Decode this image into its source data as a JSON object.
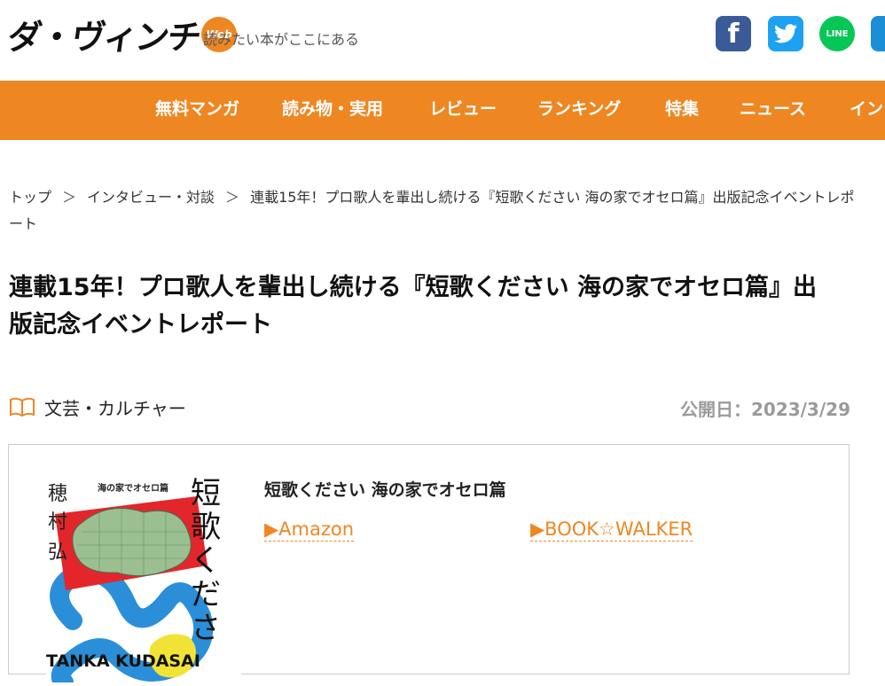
{
  "header": {
    "logo_text": "ダ・ヴィンチ",
    "logo_badge": "Web",
    "tagline": "読みたい本がここにある",
    "social": {
      "facebook": "f",
      "line": "LINE"
    }
  },
  "nav": {
    "items": [
      "無料マンガ",
      "読み物・実用",
      "レビュー",
      "ランキング",
      "特集",
      "ニュース",
      "イン"
    ]
  },
  "breadcrumb": {
    "items": [
      "トップ",
      "インタビュー・対談",
      "連載15年！プロ歌人を輩出し続ける『短歌ください 海の家でオセロ篇』出版記念イベントレポート"
    ],
    "separator": "＞"
  },
  "article": {
    "title": "連載15年！プロ歌人を輩出し続ける『短歌ください 海の家でオセロ篇』出版記念イベントレポート",
    "category": "文芸・カルチャー",
    "category_icon": "book-icon",
    "date": "公開日：2023/3/29"
  },
  "book": {
    "title": "短歌ください 海の家でオセロ篇",
    "links": [
      "▶Amazon",
      "▶BOOK☆WALKER"
    ],
    "cover": {
      "author": "穂村弘",
      "subtitle": "海の家でオセロ篇",
      "vertical_title": "短歌くださ",
      "bottom_text": "TANKA KUDASAI"
    }
  },
  "colors": {
    "accent": "#ee8722",
    "facebook": "#3b5a98",
    "twitter": "#1da1f2",
    "line": "#06c755",
    "date_gray": "#9a9a9a"
  }
}
